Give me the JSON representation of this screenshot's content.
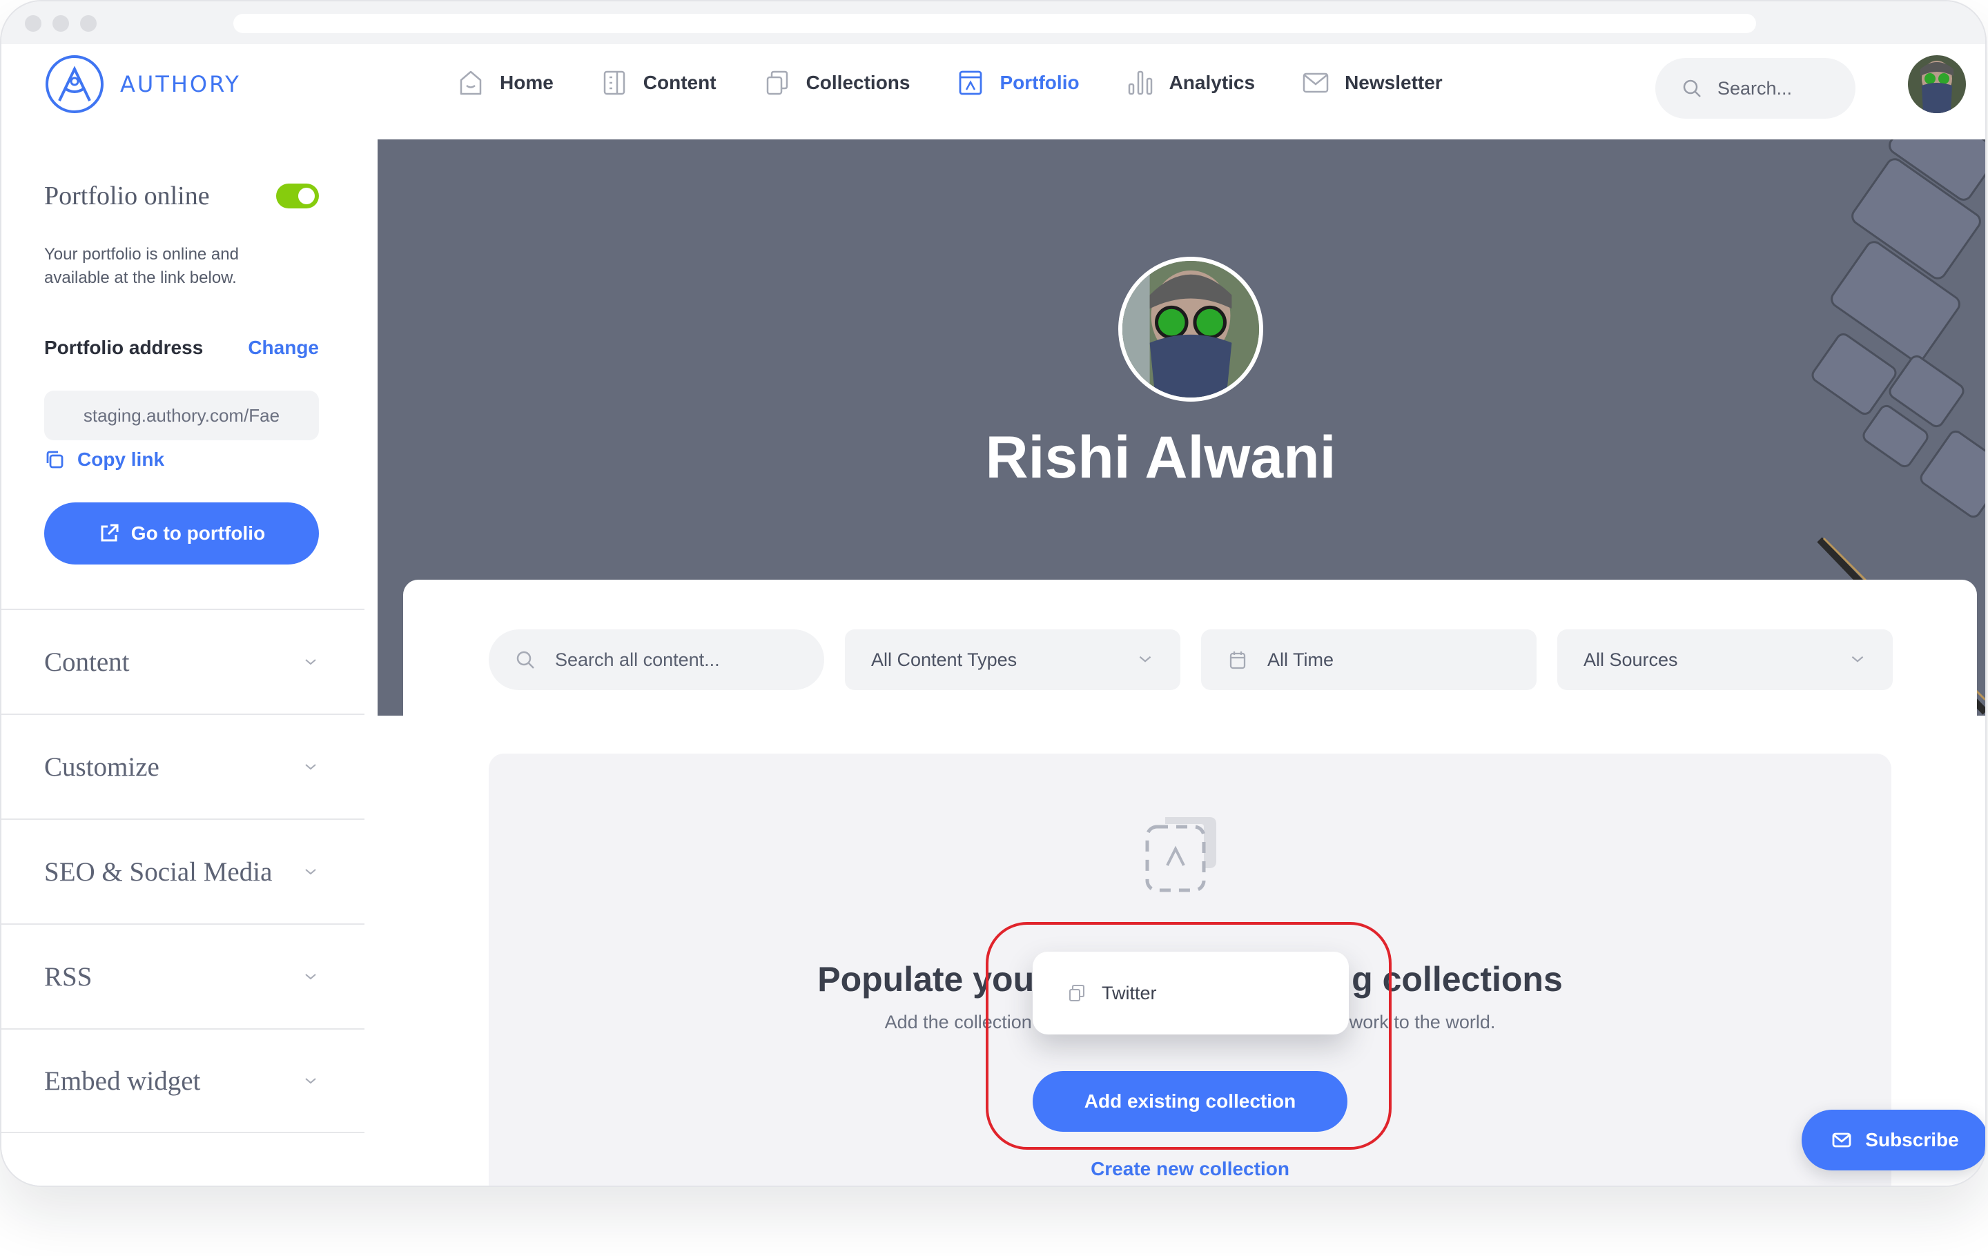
{
  "app": {
    "brand": "AUTHORY"
  },
  "nav": {
    "items": [
      {
        "label": "Home",
        "icon": "home-icon",
        "active": false
      },
      {
        "label": "Content",
        "icon": "document-icon",
        "active": false
      },
      {
        "label": "Collections",
        "icon": "collections-icon",
        "active": false
      },
      {
        "label": "Portfolio",
        "icon": "portfolio-icon",
        "active": true
      },
      {
        "label": "Analytics",
        "icon": "bar-chart-icon",
        "active": false
      },
      {
        "label": "Newsletter",
        "icon": "mail-icon",
        "active": false
      }
    ],
    "search_placeholder": "Search..."
  },
  "sidebar": {
    "online_title": "Portfolio online",
    "online_enabled": true,
    "online_description": "Your portfolio is online and available at the link below.",
    "address_label": "Portfolio address",
    "change_label": "Change",
    "address_value": "staging.authory.com/Fae",
    "copy_label": "Copy link",
    "go_label": "Go to portfolio",
    "sections": [
      {
        "label": "Content"
      },
      {
        "label": "Customize"
      },
      {
        "label": "SEO & Social Media"
      },
      {
        "label": "RSS"
      },
      {
        "label": "Embed widget"
      }
    ]
  },
  "hero": {
    "name": "Rishi Alwani"
  },
  "filters": {
    "search_placeholder": "Search all content...",
    "content_types": "All Content Types",
    "time": "All Time",
    "sources": "All Sources"
  },
  "empty_state": {
    "title_left": "Populate you",
    "title_right": "g collections",
    "subtitle_left": "Add the collection",
    "subtitle_right": "work to the world.",
    "add_label": "Add existing collection",
    "create_label": "Create new collection"
  },
  "dropdown": {
    "items": [
      {
        "label": "Twitter",
        "icon": "collection-icon"
      }
    ]
  },
  "subscribe_label": "Subscribe",
  "colors": {
    "accent": "#4378fb",
    "toggle_on": "#86cc0d",
    "hero_bg": "#656b7b",
    "highlight": "#e0242c"
  }
}
